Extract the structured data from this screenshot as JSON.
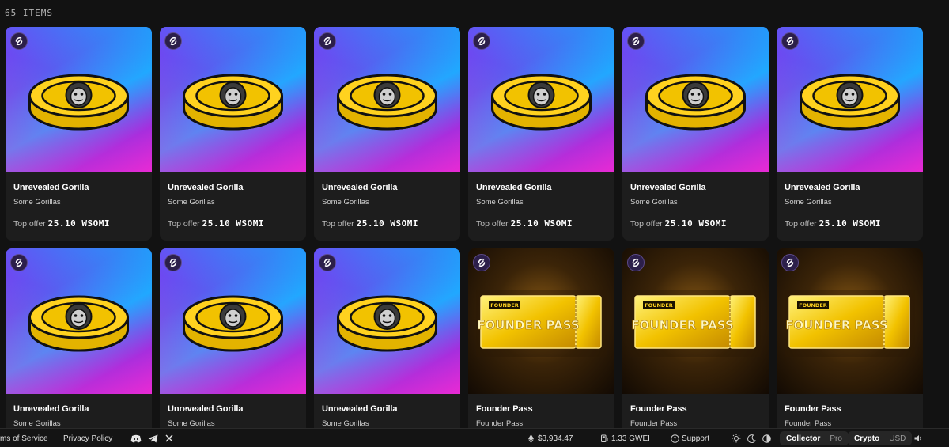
{
  "collection": {
    "items_count": "65 ITEMS"
  },
  "cards": [
    {
      "title": "Unrevealed Gorilla",
      "collection": "Some Gorillas",
      "offer_label": "Top offer",
      "offer_value": "25.10 WSOMI",
      "art": "gold-gorilla-coin"
    },
    {
      "title": "Unrevealed Gorilla",
      "collection": "Some Gorillas",
      "offer_label": "Top offer",
      "offer_value": "25.10 WSOMI",
      "art": "gold-gorilla-coin"
    },
    {
      "title": "Unrevealed Gorilla",
      "collection": "Some Gorillas",
      "offer_label": "Top offer",
      "offer_value": "25.10 WSOMI",
      "art": "gold-gorilla-coin"
    },
    {
      "title": "Unrevealed Gorilla",
      "collection": "Some Gorillas",
      "offer_label": "Top offer",
      "offer_value": "25.10 WSOMI",
      "art": "gold-gorilla-coin"
    },
    {
      "title": "Unrevealed Gorilla",
      "collection": "Some Gorillas",
      "offer_label": "Top offer",
      "offer_value": "25.10 WSOMI",
      "art": "gold-gorilla-coin"
    },
    {
      "title": "Unrevealed Gorilla",
      "collection": "Some Gorillas",
      "offer_label": "Top offer",
      "offer_value": "25.10 WSOMI",
      "art": "gold-gorilla-coin"
    },
    {
      "title": "Unrevealed Gorilla",
      "collection": "Some Gorillas",
      "art": "gold-gorilla-coin"
    },
    {
      "title": "Unrevealed Gorilla",
      "collection": "Some Gorillas",
      "art": "gold-gorilla-coin"
    },
    {
      "title": "Unrevealed Gorilla",
      "collection": "Some Gorillas",
      "art": "gold-gorilla-coin"
    },
    {
      "title": "Founder Pass",
      "collection": "Founder Pass",
      "art": "founder-pass-ticket"
    },
    {
      "title": "Founder Pass",
      "collection": "Founder Pass",
      "art": "founder-pass-ticket"
    },
    {
      "title": "Founder Pass",
      "collection": "Founder Pass",
      "art": "founder-pass-ticket"
    }
  ],
  "ticket_art": {
    "small": "FOUNDER",
    "big": "FOUNDER PASS"
  },
  "footer": {
    "terms": "ms of Service",
    "privacy": "Privacy Policy",
    "socials": [
      "discord-icon",
      "telegram-icon",
      "x-icon"
    ],
    "eth_price": "$3,934.47",
    "gas": "1.33 GWEI",
    "support": "Support",
    "mode_toggle": {
      "collector": "Collector",
      "pro": "Pro"
    },
    "currency_toggle": {
      "crypto": "Crypto",
      "usd": "USD"
    }
  },
  "colors": {
    "background": "#121212",
    "card": "#1d1d1d",
    "gold": "#f5c518",
    "badge": "#2c1f4a"
  }
}
